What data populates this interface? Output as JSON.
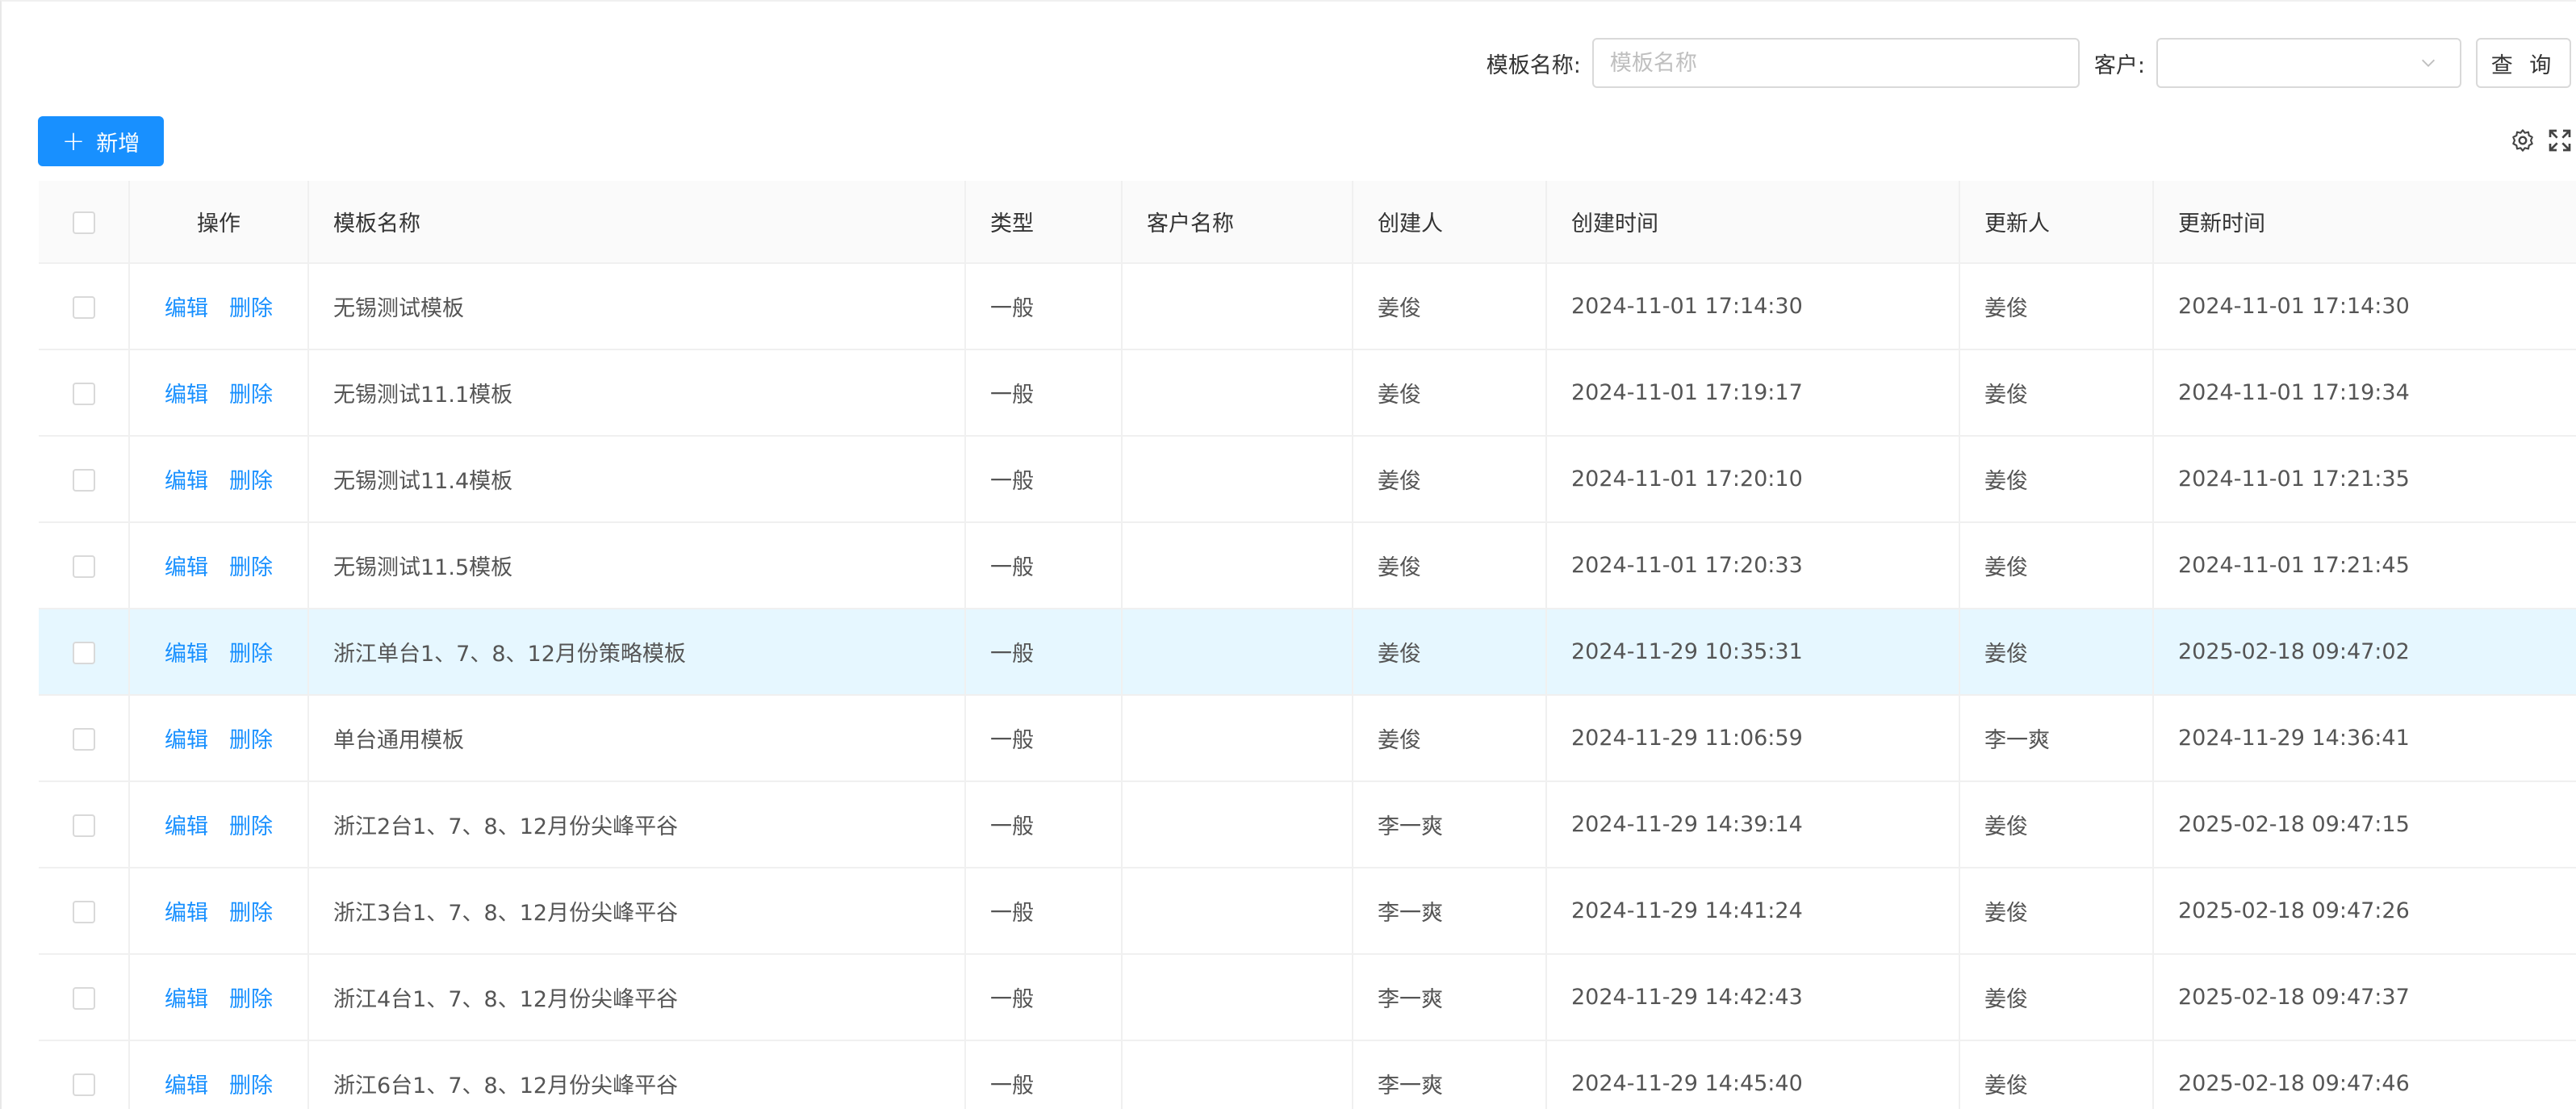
{
  "search": {
    "template_name_label": "模板名称:",
    "template_name_placeholder": "模板名称",
    "template_name_value": "",
    "customer_label": "客户:",
    "customer_value": "",
    "query_button": "查 询"
  },
  "toolbar": {
    "add_plus": "+",
    "add_label": "新增",
    "icons": [
      "settings-icon",
      "fullscreen-icon"
    ]
  },
  "colors": {
    "primary": "#1890ff",
    "row_highlight": "#e6f7ff",
    "header_bg": "#fafafa"
  },
  "table": {
    "headers": [
      "操作",
      "模板名称",
      "类型",
      "客户名称",
      "创建人",
      "创建时间",
      "更新人",
      "更新时间"
    ],
    "edit_label": "编辑",
    "delete_label": "删除",
    "highlighted_row": 4,
    "rows": [
      {
        "name": "无锡测试模板",
        "type": "一般",
        "customer": "",
        "creator": "姜俊",
        "created": "2024-11-01 17:14:30",
        "updater": "姜俊",
        "updated": "2024-11-01 17:14:30"
      },
      {
        "name": "无锡测试11.1模板",
        "type": "一般",
        "customer": "",
        "creator": "姜俊",
        "created": "2024-11-01 17:19:17",
        "updater": "姜俊",
        "updated": "2024-11-01 17:19:34"
      },
      {
        "name": "无锡测试11.4模板",
        "type": "一般",
        "customer": "",
        "creator": "姜俊",
        "created": "2024-11-01 17:20:10",
        "updater": "姜俊",
        "updated": "2024-11-01 17:21:35"
      },
      {
        "name": "无锡测试11.5模板",
        "type": "一般",
        "customer": "",
        "creator": "姜俊",
        "created": "2024-11-01 17:20:33",
        "updater": "姜俊",
        "updated": "2024-11-01 17:21:45"
      },
      {
        "name": "浙江单台1、7、8、12月份策略模板",
        "type": "一般",
        "customer": "",
        "creator": "姜俊",
        "created": "2024-11-29 10:35:31",
        "updater": "姜俊",
        "updated": "2025-02-18 09:47:02"
      },
      {
        "name": "单台通用模板",
        "type": "一般",
        "customer": "",
        "creator": "姜俊",
        "created": "2024-11-29 11:06:59",
        "updater": "李一爽",
        "updated": "2024-11-29 14:36:41"
      },
      {
        "name": "浙江2台1、7、8、12月份尖峰平谷",
        "type": "一般",
        "customer": "",
        "creator": "李一爽",
        "created": "2024-11-29 14:39:14",
        "updater": "姜俊",
        "updated": "2025-02-18 09:47:15"
      },
      {
        "name": "浙江3台1、7、8、12月份尖峰平谷",
        "type": "一般",
        "customer": "",
        "creator": "李一爽",
        "created": "2024-11-29 14:41:24",
        "updater": "姜俊",
        "updated": "2025-02-18 09:47:26"
      },
      {
        "name": "浙江4台1、7、8、12月份尖峰平谷",
        "type": "一般",
        "customer": "",
        "creator": "李一爽",
        "created": "2024-11-29 14:42:43",
        "updater": "姜俊",
        "updated": "2025-02-18 09:47:37"
      },
      {
        "name": "浙江6台1、7、8、12月份尖峰平谷",
        "type": "一般",
        "customer": "",
        "creator": "李一爽",
        "created": "2024-11-29 14:45:40",
        "updater": "姜俊",
        "updated": "2025-02-18 09:47:46"
      }
    ]
  }
}
